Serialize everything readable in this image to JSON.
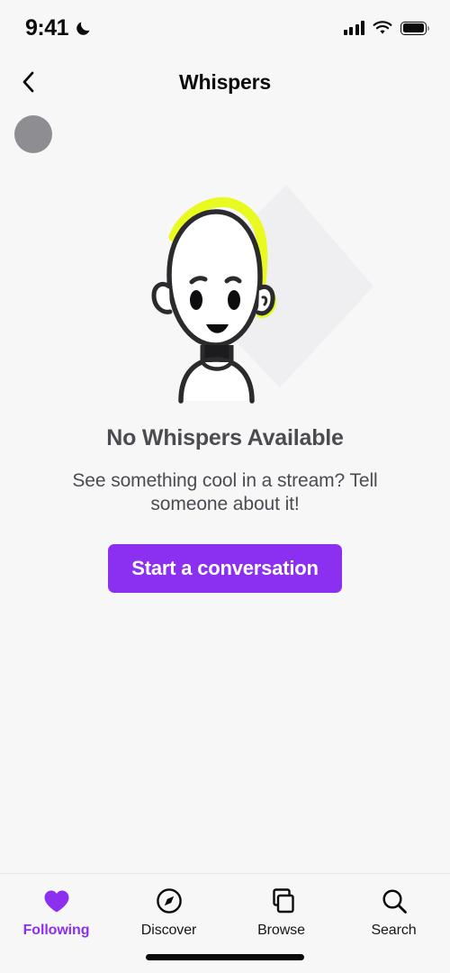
{
  "status_bar": {
    "time": "9:41",
    "dnd_icon": "crescent-moon-icon",
    "signal_icon": "cellular-signal-icon",
    "wifi_icon": "wifi-icon",
    "battery_icon": "battery-full-icon"
  },
  "nav": {
    "back_icon": "chevron-left-icon",
    "title": "Whispers"
  },
  "avatar": {
    "name": "avatar-placeholder",
    "color": "#8e8e92"
  },
  "empty_state": {
    "illustration": "person-face-illustration",
    "title": "No Whispers Available",
    "subtitle": "See something cool in a stream? Tell someone about it!",
    "cta_label": "Start a conversation"
  },
  "colors": {
    "accent": "#8b2ff0",
    "highlight": "#e8fa20",
    "background": "#f7f7f8",
    "text": "#4b4b52",
    "ink": "#2b2b2e"
  },
  "tabs": [
    {
      "label": "Following",
      "icon": "heart-icon",
      "active": true
    },
    {
      "label": "Discover",
      "icon": "compass-icon",
      "active": false
    },
    {
      "label": "Browse",
      "icon": "copy-icon",
      "active": false
    },
    {
      "label": "Search",
      "icon": "search-icon",
      "active": false
    }
  ]
}
